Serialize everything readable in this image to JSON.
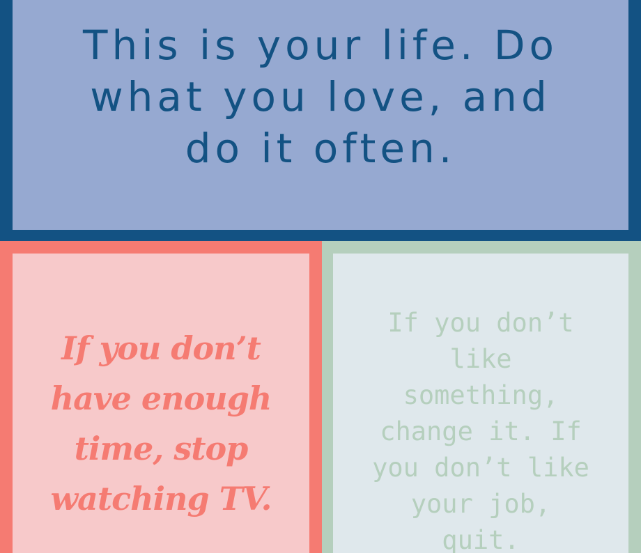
{
  "cards": {
    "top": {
      "quote_lines": [
        "This is your life. Do",
        "what you love, and",
        "do it often."
      ]
    },
    "bottom_left": {
      "quote_lines": [
        "If you don’t",
        "have enough",
        "time, stop",
        "watching TV."
      ]
    },
    "bottom_right": {
      "quote_lines": [
        "If you don’t",
        "like",
        "something,",
        "change it. If",
        "you don’t like",
        "your job,",
        "quit."
      ]
    }
  },
  "colors": {
    "top_background": "#96a9d1",
    "top_border": "#135283",
    "left_background": "#f7c9ca",
    "left_border": "#f57b72",
    "right_background": "#dfe8ec",
    "right_border": "#b5cfbd"
  }
}
